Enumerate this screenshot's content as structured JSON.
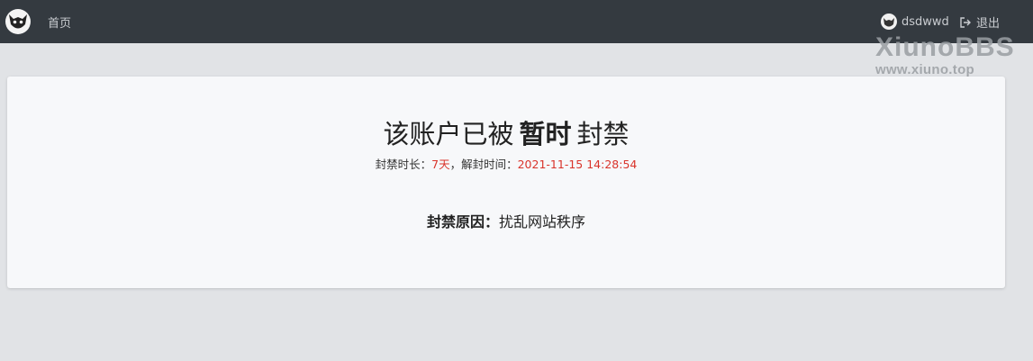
{
  "navbar": {
    "logo_icon": "hedgehog-logo-icon",
    "home_label": "首页",
    "user": {
      "avatar_icon": "user-avatar-icon",
      "name": "dsdwwd"
    },
    "logout": {
      "icon": "sign-out-icon",
      "label": "退出"
    }
  },
  "watermark": {
    "top": "XiunoBBS",
    "bottom": "www.xiuno.top"
  },
  "ban": {
    "title_prefix": "该账户已被",
    "title_strong": "暂时",
    "title_suffix": "封禁",
    "duration_label": "封禁时长：",
    "duration_value": "7天",
    "separator": "，",
    "unban_label": "解封时间：",
    "unban_value": "2021-11-15 14:28:54",
    "reason_label": "封禁原因：",
    "reason_value": "扰乱网站秩序"
  },
  "colors": {
    "navbar_bg": "#343a40",
    "page_bg": "#e1e3e6",
    "card_bg": "#f7f8fa",
    "highlight_red": "#d9342b"
  }
}
